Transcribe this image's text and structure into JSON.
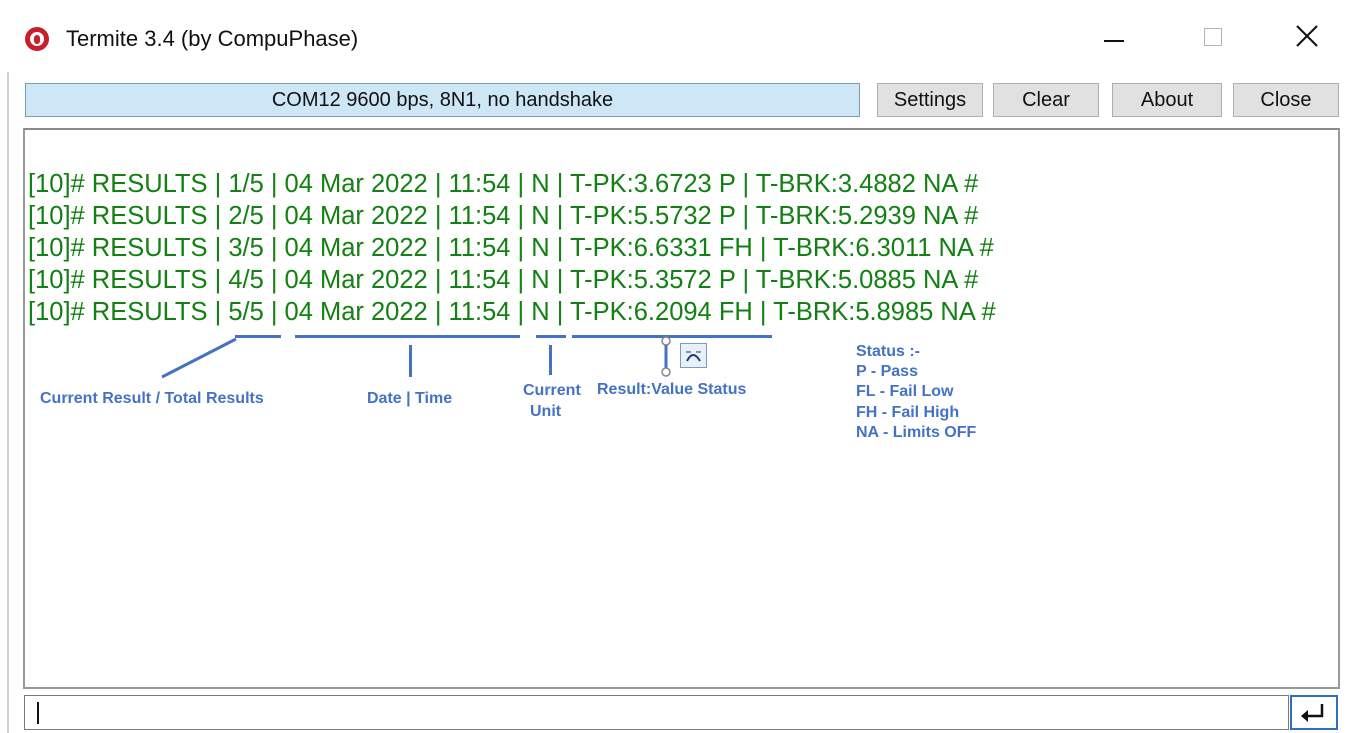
{
  "window": {
    "title": "Termite 3.4 (by CompuPhase)",
    "icon": "termite-bug-icon",
    "controls": [
      "minimize-icon",
      "maximize-icon",
      "close-icon"
    ]
  },
  "toolbar": {
    "status": "COM12 9600 bps, 8N1, no handshake",
    "settings_label": "Settings",
    "clear_label": "Clear",
    "about_label": "About",
    "close_label": "Close"
  },
  "output": {
    "lines": [
      "[10]# RESULTS | 1/5 | 04 Mar 2022 | 11:54 | N | T-PK:3.6723 P | T-BRK:3.4882 NA #",
      "[10]# RESULTS | 2/5 | 04 Mar 2022 | 11:54 | N | T-PK:5.5732 P | T-BRK:5.2939 NA #",
      "[10]# RESULTS | 3/5 | 04 Mar 2022 | 11:54 | N | T-PK:6.6331 FH | T-BRK:6.3011 NA #",
      "[10]# RESULTS | 4/5 | 04 Mar 2022 | 11:54 | N | T-PK:5.3572 P | T-BRK:5.0885 NA #",
      "[10]# RESULTS | 5/5 | 04 Mar 2022 | 11:54 | N | T-PK:6.2094 FH | T-BRK:5.8985 NA #"
    ],
    "text_color": "#128012"
  },
  "annotations": {
    "current_result": "Current Result / Total Results",
    "date_time": "Date | Time",
    "current_unit_1": "Current",
    "current_unit_2": "Unit",
    "result_value_status": "Result:Value Status",
    "status_legend": [
      "Status :-",
      "P - Pass",
      "FL - Fail Low",
      "FH - Fail High",
      "NA - Limits OFF"
    ],
    "color": "#4472c4"
  },
  "input": {
    "value": "",
    "send_icon": "enter-arrow-icon"
  }
}
